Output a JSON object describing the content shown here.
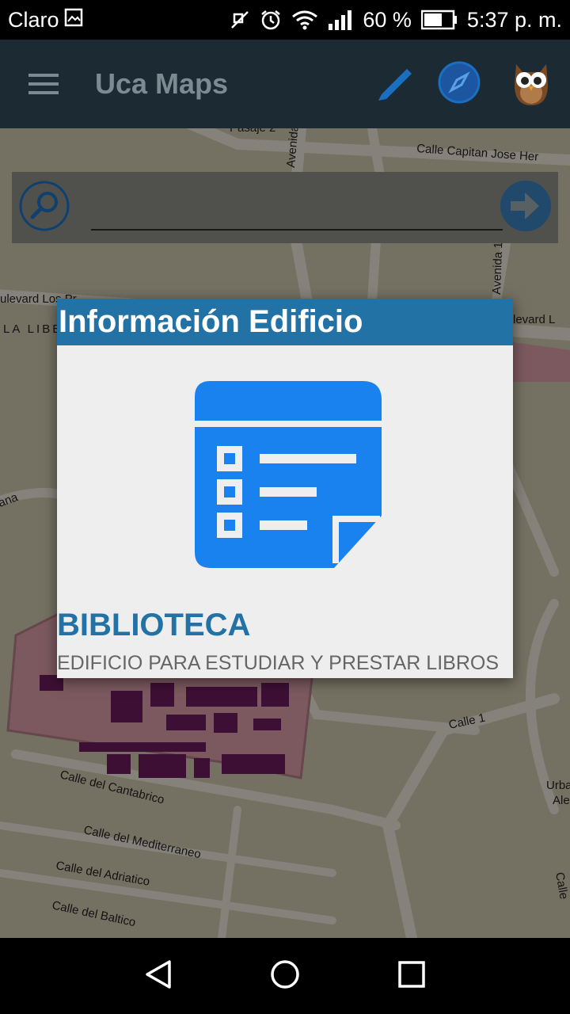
{
  "status_bar": {
    "carrier": "Claro",
    "battery": "60 %",
    "time": "5:37 p. m."
  },
  "app_bar": {
    "title": "Uca Maps"
  },
  "search": {
    "placeholder": ""
  },
  "map_labels": {
    "pasaje": "Pasaje 2",
    "capitan": "Calle Capitan Jose Her",
    "avenida_top": "Avenida",
    "avenida_right": "Avenida 1",
    "boulevard_left": "ulevard Los Pr",
    "la_libe": "LA LIBE",
    "boulevard_right": "levard L",
    "ana": "ana",
    "cantabrico": "Calle del Cantabrico",
    "mediterraneo": "Calle del Mediterraneo",
    "adriatico": "Calle del Adriatico",
    "baltico": "Calle del Baltico",
    "calle1": "Calle 1",
    "urba": "Urba",
    "ale": "Ale",
    "calle_edge": "Calle"
  },
  "dialog": {
    "header": "Información Edificio",
    "building_name": "BIBLIOTECA",
    "building_description": "EDIFICIO PARA ESTUDIAR Y PRESTAR LIBROS"
  },
  "colors": {
    "app_bar": "#1c2a34",
    "accent": "#2372a6",
    "icon_blue": "#1a82ef",
    "building": "#6a1a5a"
  }
}
